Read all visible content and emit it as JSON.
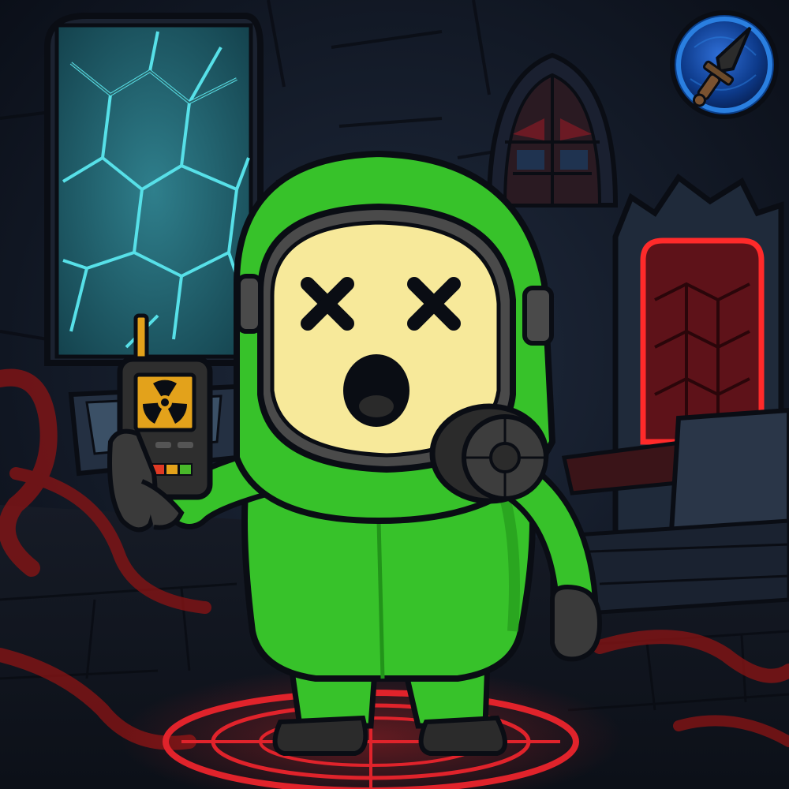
{
  "scene": {
    "setting": "dungeon-throne-room",
    "ability_slot": {
      "icon": "dagger-icon",
      "ring_color": "#2a7fe0",
      "fill_color": "#0b3f8a"
    },
    "character": {
      "state": "dead",
      "suit_color": "#37c22a",
      "suit_shadow": "#22931a",
      "face_color": "#f7e99a",
      "held_item": "geiger-counter-icon",
      "item_screen_icon": "radiation-icon",
      "item_buttons": [
        "#e03a24",
        "#e3a21b",
        "#49b82a"
      ]
    },
    "floor_sigil_color": "#e0232b",
    "throne_glow_color": "#ff2a2a",
    "window_crack_color": "#57e0e8"
  }
}
